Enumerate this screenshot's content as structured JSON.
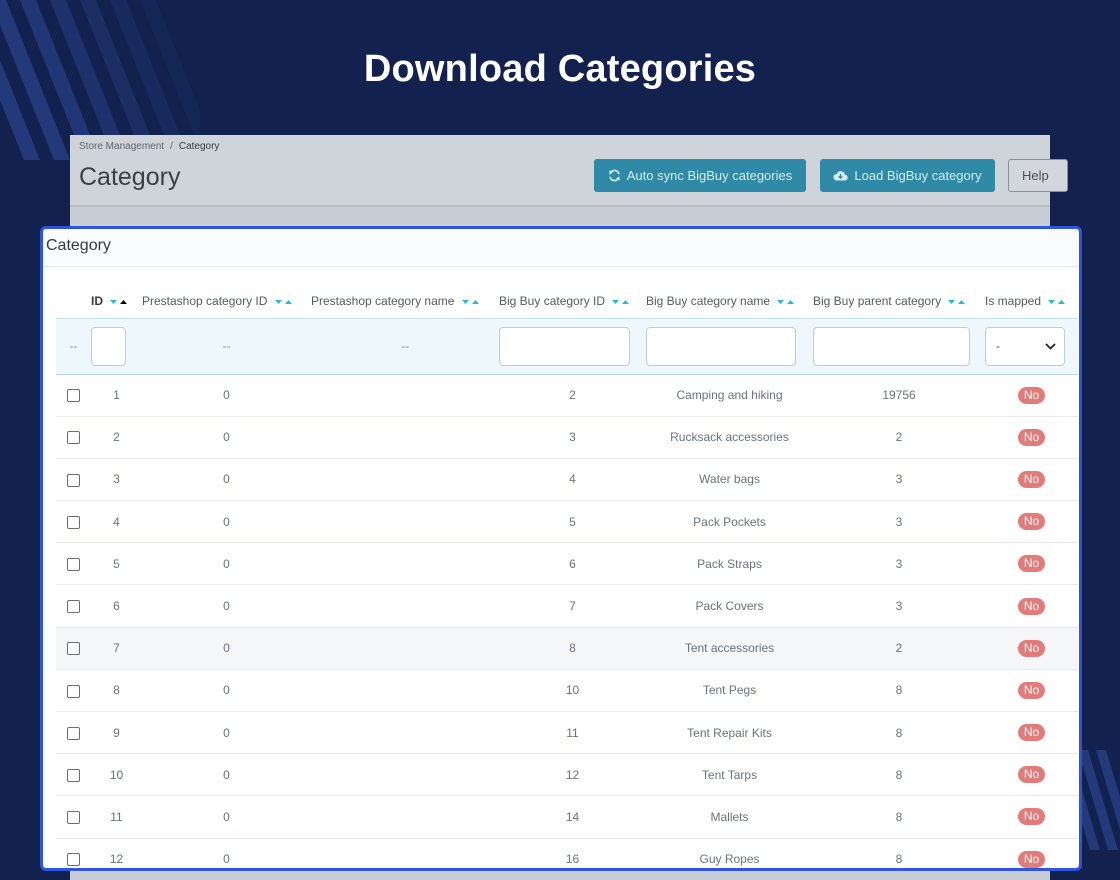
{
  "hero": {
    "title": "Download Categories"
  },
  "colors": {
    "background": "#12214d",
    "accent": "#2f55e0",
    "primary_button": "#2e8aa6",
    "badge_no": "#e47b7b"
  },
  "header": {
    "breadcrumb": {
      "parent": "Store Management",
      "separator": "/",
      "current": "Category"
    },
    "title": "Category",
    "buttons": {
      "auto_sync": "Auto sync BigBuy categories",
      "load": "Load BigBuy category",
      "help": "Help"
    },
    "icons": {
      "auto_sync": "refresh-icon",
      "load": "cloud-download-icon"
    }
  },
  "panel": {
    "title": "Category",
    "columns": {
      "id": "ID",
      "prestashop_id": "Prestashop category ID",
      "prestashop_name": "Prestashop category name",
      "bigbuy_id": "Big Buy category ID",
      "bigbuy_name": "Big Buy category name",
      "bigbuy_parent": "Big Buy parent category",
      "is_mapped": "Is mapped"
    },
    "filters": {
      "placeholder_dash": "--",
      "is_mapped_selected": "-"
    },
    "rows": [
      {
        "id": "1",
        "prestashop_id": "0",
        "bigbuy_id": "2",
        "bigbuy_name": "Camping and hiking",
        "parent": "19756",
        "mapped": "No"
      },
      {
        "id": "2",
        "prestashop_id": "0",
        "bigbuy_id": "3",
        "bigbuy_name": "Rucksack accessories",
        "parent": "2",
        "mapped": "No"
      },
      {
        "id": "3",
        "prestashop_id": "0",
        "bigbuy_id": "4",
        "bigbuy_name": "Water bags",
        "parent": "3",
        "mapped": "No"
      },
      {
        "id": "4",
        "prestashop_id": "0",
        "bigbuy_id": "5",
        "bigbuy_name": "Pack Pockets",
        "parent": "3",
        "mapped": "No"
      },
      {
        "id": "5",
        "prestashop_id": "0",
        "bigbuy_id": "6",
        "bigbuy_name": "Pack Straps",
        "parent": "3",
        "mapped": "No"
      },
      {
        "id": "6",
        "prestashop_id": "0",
        "bigbuy_id": "7",
        "bigbuy_name": "Pack Covers",
        "parent": "3",
        "mapped": "No"
      },
      {
        "id": "7",
        "prestashop_id": "0",
        "bigbuy_id": "8",
        "bigbuy_name": "Tent accessories",
        "parent": "2",
        "mapped": "No"
      },
      {
        "id": "8",
        "prestashop_id": "0",
        "bigbuy_id": "10",
        "bigbuy_name": "Tent Pegs",
        "parent": "8",
        "mapped": "No"
      },
      {
        "id": "9",
        "prestashop_id": "0",
        "bigbuy_id": "11",
        "bigbuy_name": "Tent Repair Kits",
        "parent": "8",
        "mapped": "No"
      },
      {
        "id": "10",
        "prestashop_id": "0",
        "bigbuy_id": "12",
        "bigbuy_name": "Tent Tarps",
        "parent": "8",
        "mapped": "No"
      },
      {
        "id": "11",
        "prestashop_id": "0",
        "bigbuy_id": "14",
        "bigbuy_name": "Mallets",
        "parent": "8",
        "mapped": "No"
      },
      {
        "id": "12",
        "prestashop_id": "0",
        "bigbuy_id": "16",
        "bigbuy_name": "Guy Ropes",
        "parent": "8",
        "mapped": "No"
      }
    ]
  }
}
